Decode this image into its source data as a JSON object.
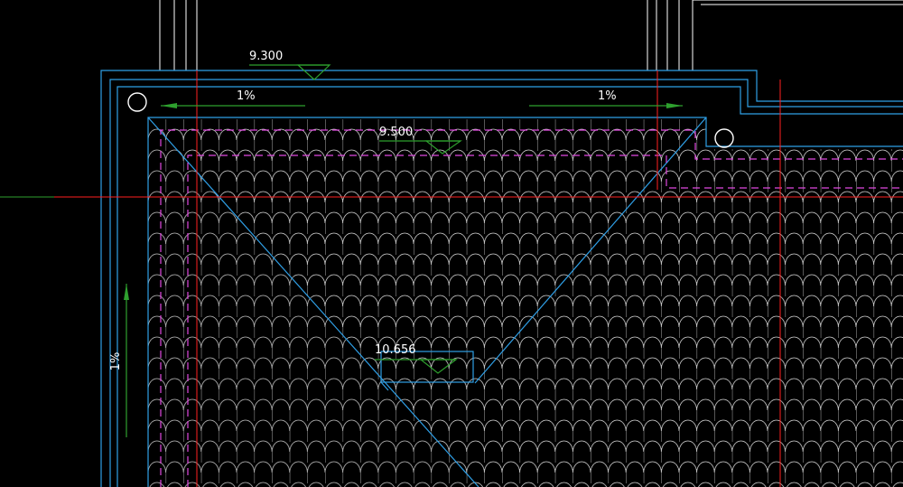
{
  "drawing": {
    "background_color": "#000000",
    "layer_colors": {
      "outline": "#2f9fe6",
      "wall": "#ffffff",
      "tile": "#d8d8d8",
      "axis": "#ff2020",
      "dashed_offset": "#e048e0",
      "slope_arrow": "#2ea02e",
      "elevation_marker": "#2ea02e"
    }
  },
  "elevations": [
    {
      "value": "9.300"
    },
    {
      "value": "9.500"
    },
    {
      "value": "10.656"
    }
  ],
  "slopes": [
    {
      "value": "1%",
      "direction": "left"
    },
    {
      "value": "1%",
      "direction": "right"
    },
    {
      "value": "1%",
      "direction": "up"
    }
  ],
  "markers": [
    {
      "symbol": "circle"
    },
    {
      "symbol": "circle"
    }
  ]
}
